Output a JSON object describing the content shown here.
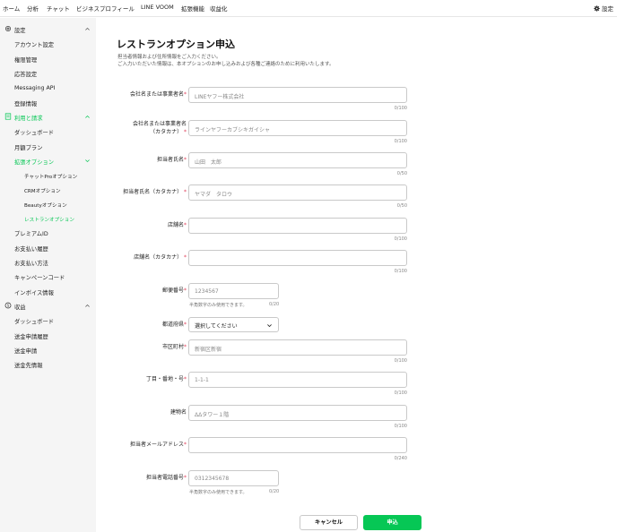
{
  "topnav": {
    "items": [
      "ホーム",
      "分析",
      "チャット",
      "ビジネスプロフィール",
      "LINE VOOM",
      "拡張機能",
      "収益化"
    ],
    "settings_label": "設定"
  },
  "sidebar": {
    "sections": [
      {
        "label": "設定",
        "icon": "gear-icon"
      },
      {
        "label": "利用と請求",
        "icon": "billing-icon"
      },
      {
        "label": "収益",
        "icon": "currency-icon"
      }
    ],
    "settings_items": [
      "アカウント設定",
      "権限管理",
      "応答設定",
      "Messaging API",
      "登録情報"
    ],
    "billing_items": [
      "ダッシュボード",
      "月額プラン"
    ],
    "extension_label": "拡張オプション",
    "extension_items": [
      "チャットProオプション",
      "CRMオプション",
      "Beautyオプション",
      "レストランオプション"
    ],
    "billing_items2": [
      "プレミアムID",
      "お支払い履歴",
      "お支払い方法",
      "キャンペーンコード",
      "インボイス情報"
    ],
    "revenue_items": [
      "ダッシュボード",
      "送金申請履歴",
      "送金申請",
      "送金先情報"
    ]
  },
  "page": {
    "title": "レストランオプション申込",
    "desc_line1": "担当者情報および住所情報をご入力ください。",
    "desc_line2": "ご入力いただいた情報は、本オプションのお申し込みおよび各種ご連絡のために利用いたします。"
  },
  "form": {
    "company_name": {
      "label": "会社名または事業者名",
      "required": "*",
      "placeholder": "LINEヤフー株式会社",
      "count": "0/100"
    },
    "company_kana": {
      "label_line1": "会社名または事業者名",
      "label_line2": "（カタカナ）",
      "required": "*",
      "placeholder": "ラインヤフーカブシキガイシャ",
      "count": "0/100"
    },
    "contact_name": {
      "label": "担当者氏名",
      "required": "*",
      "placeholder": "山田　太郎",
      "count": "0/50"
    },
    "contact_kana": {
      "label": "担当者氏名（カタカナ）",
      "required": "*",
      "placeholder": "ヤマダ　タロウ",
      "count": "0/50"
    },
    "store_name": {
      "label": "店舗名",
      "required": "*",
      "placeholder": "",
      "count": "0/100"
    },
    "store_kana": {
      "label": "店舗名（カタカナ）",
      "required": "*",
      "placeholder": "",
      "count": "0/100"
    },
    "postal_code": {
      "label": "郵便番号",
      "required": "*",
      "placeholder": "1234567",
      "hint": "半角数字のみ使用できます。",
      "count": "0/20"
    },
    "prefecture": {
      "label": "都道府県",
      "required": "*",
      "value": "選択してください"
    },
    "city": {
      "label": "市区町村",
      "required": "*",
      "placeholder": "新宿区新宿",
      "count": "0/100"
    },
    "address": {
      "label": "丁目・番地・号",
      "required": "*",
      "placeholder": "1-1-1",
      "count": "0/100"
    },
    "building": {
      "label": "建物名",
      "required": "",
      "placeholder": "ΔΔタワー１階",
      "count": "0/100"
    },
    "email": {
      "label": "担当者メールアドレス",
      "required": "*",
      "placeholder": "",
      "count": "0/240"
    },
    "phone": {
      "label": "担当者電話番号",
      "required": "*",
      "placeholder": "0312345678",
      "hint": "半角数字のみ使用できます。",
      "count": "0/20"
    }
  },
  "buttons": {
    "cancel": "キャンセル",
    "submit": "申込"
  },
  "colors": {
    "accent": "#06c755",
    "required": "#e0405a"
  }
}
